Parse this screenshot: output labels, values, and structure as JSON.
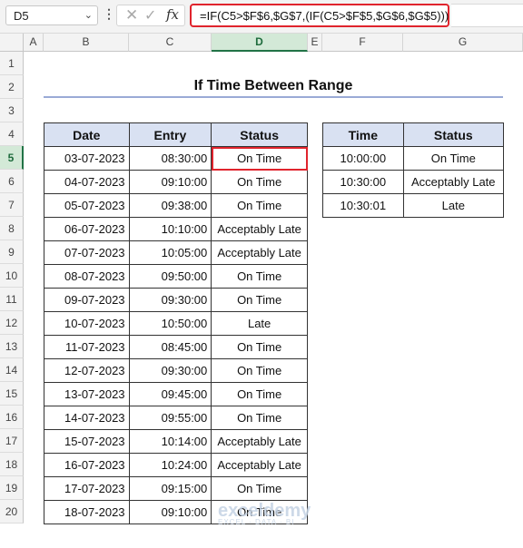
{
  "formula_bar": {
    "name_box": "D5",
    "formula": "=IF(C5>$F$6,$G$7,(IF(C5>$F$5,$G$6,$G$5)))",
    "fx_label": "fx",
    "more_icon": "vertical-ellipsis-icon",
    "cancel_icon": "cancel-x-icon",
    "enter_icon": "checkmark-icon"
  },
  "columns": [
    "A",
    "B",
    "C",
    "D",
    "E",
    "F",
    "G"
  ],
  "rows": [
    "1",
    "2",
    "3",
    "4",
    "5",
    "6",
    "7",
    "8",
    "9",
    "10",
    "11",
    "12",
    "13",
    "14",
    "15",
    "16",
    "17",
    "18",
    "19",
    "20"
  ],
  "title": "If Time Between Range",
  "main_table": {
    "headers": [
      "Date",
      "Entry",
      "Status"
    ],
    "rows": [
      [
        "03-07-2023",
        "08:30:00",
        "On Time"
      ],
      [
        "04-07-2023",
        "09:10:00",
        "On Time"
      ],
      [
        "05-07-2023",
        "09:38:00",
        "On Time"
      ],
      [
        "06-07-2023",
        "10:10:00",
        "Acceptably Late"
      ],
      [
        "07-07-2023",
        "10:05:00",
        "Acceptably Late"
      ],
      [
        "08-07-2023",
        "09:50:00",
        "On Time"
      ],
      [
        "09-07-2023",
        "09:30:00",
        "On Time"
      ],
      [
        "10-07-2023",
        "10:50:00",
        "Late"
      ],
      [
        "11-07-2023",
        "08:45:00",
        "On Time"
      ],
      [
        "12-07-2023",
        "09:30:00",
        "On Time"
      ],
      [
        "13-07-2023",
        "09:45:00",
        "On Time"
      ],
      [
        "14-07-2023",
        "09:55:00",
        "On Time"
      ],
      [
        "15-07-2023",
        "10:14:00",
        "Acceptably Late"
      ],
      [
        "16-07-2023",
        "10:24:00",
        "Acceptably Late"
      ],
      [
        "17-07-2023",
        "09:15:00",
        "On Time"
      ],
      [
        "18-07-2023",
        "09:10:00",
        "On Time"
      ]
    ]
  },
  "lookup_table": {
    "headers": [
      "Time",
      "Status"
    ],
    "rows": [
      [
        "10:00:00",
        "On Time"
      ],
      [
        "10:30:00",
        "Acceptably Late"
      ],
      [
        "10:30:01",
        "Late"
      ]
    ]
  },
  "watermark": {
    "brand": "exceldemy",
    "tagline": "EXCEL · DATA · BI"
  },
  "colors": {
    "header_fill": "#d9e1f2",
    "highlight": "#e0242d",
    "selected_header": "#d3e9d7"
  }
}
